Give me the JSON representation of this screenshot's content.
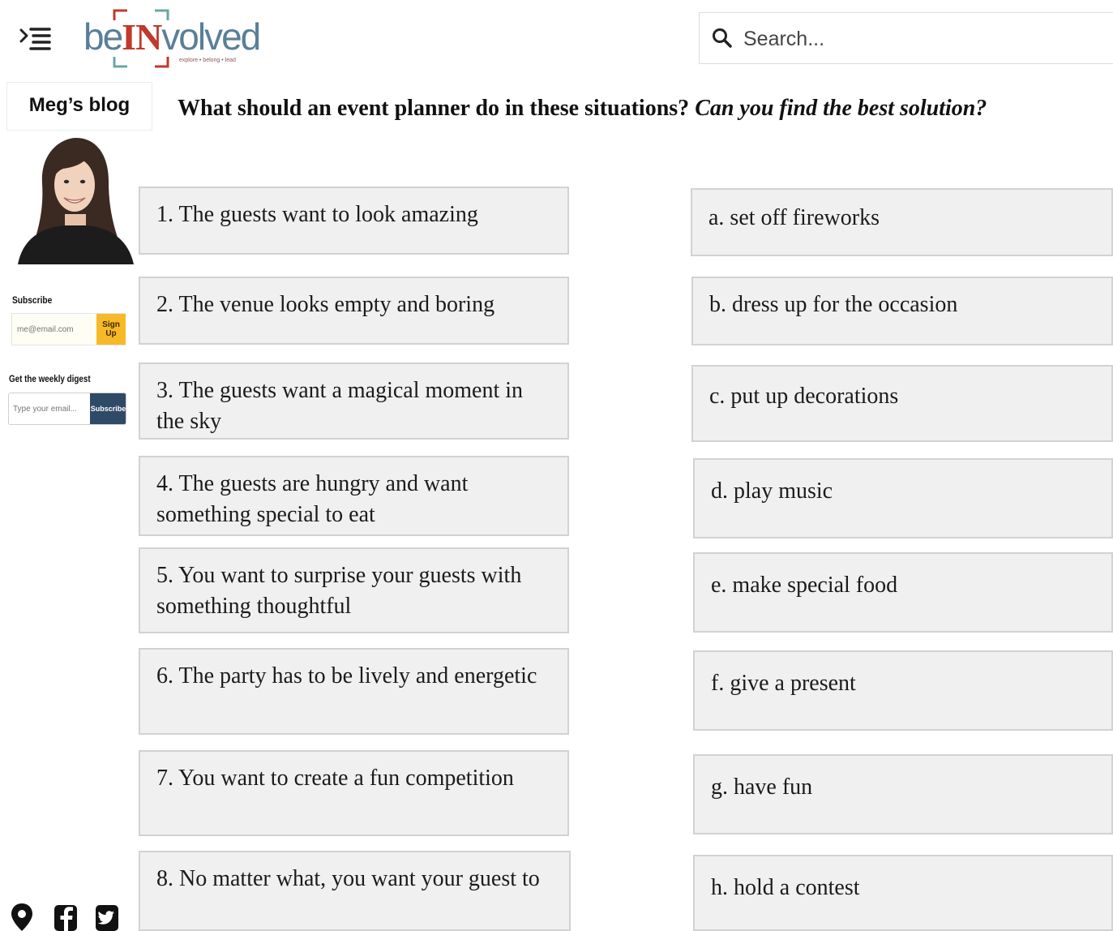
{
  "header": {
    "logo": {
      "prefix": "be",
      "highlight": "IN",
      "suffix": "volved",
      "tagline": "explore • belong • lead"
    },
    "search": {
      "placeholder": "Search..."
    }
  },
  "sidebar": {
    "blog_label": "Meg’s blog",
    "subscribe": {
      "title": "Subscribe",
      "placeholder": "me@email.com",
      "button": "Sign Up"
    },
    "digest": {
      "title": "Get the weekly digest",
      "placeholder": "Type your email...",
      "button": "Subscribe"
    },
    "social_icons": [
      "map-pin-icon",
      "facebook-icon",
      "twitter-icon"
    ]
  },
  "main": {
    "title": "What should an event planner do in these situations?",
    "subtitle": "Can you find the best solution?",
    "situations": [
      "1. The guests want to look amazing",
      "2. The venue looks empty and boring",
      "3. The guests want a magical moment in the sky",
      "4. The guests are hungry and want something special to eat",
      "5. You want to surprise your guests with something thoughtful",
      "6. The party has to be lively and energetic",
      "7. You want to create a fun competition",
      "8. No matter what, you want your guest to"
    ],
    "solutions": [
      "a. set off fireworks",
      "b. dress up for the occasion",
      "c. put up decorations",
      "d. play music",
      "e. make special food",
      "f. give a present",
      "g. have fun",
      "h. hold a contest"
    ]
  },
  "colors": {
    "card_bg": "#f0f0f0",
    "card_border": "#d2d2d2",
    "logo_blue": "#5a7f98",
    "logo_red": "#c0392b",
    "signup_button": "#f7b928",
    "digest_button": "#2f4a66"
  }
}
